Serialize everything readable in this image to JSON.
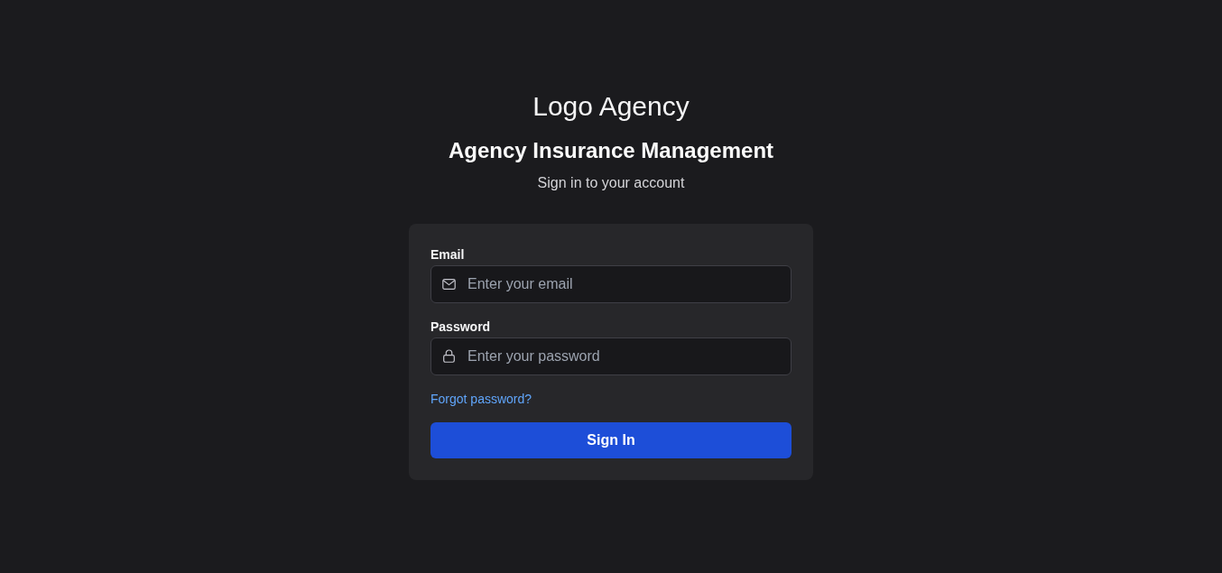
{
  "brand": {
    "logo_text": "Logo Agency"
  },
  "heading": "Agency Insurance Management",
  "subtitle": "Sign in to your account",
  "form": {
    "fields": [
      {
        "kind": "email",
        "label": "Email",
        "placeholder": "Enter your email"
      },
      {
        "kind": "password",
        "label": "Password",
        "placeholder": "Enter your password"
      }
    ],
    "forgot_link": "Forgot password?",
    "submit": "Sign In"
  }
}
